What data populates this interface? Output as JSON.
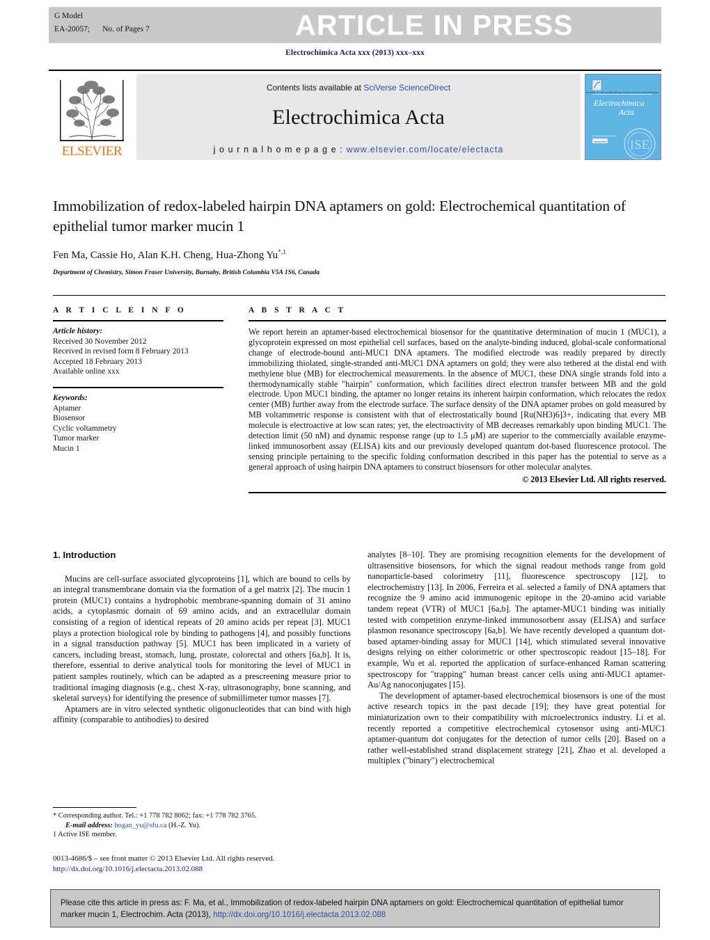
{
  "banner": {
    "g_model": "G Model",
    "article_id": "EA-20057;",
    "pages": "No. of Pages 7",
    "status": "ARTICLE IN PRESS"
  },
  "journal_citation": "Electrochimica Acta xxx (2013) xxx–xxx",
  "masthead": {
    "contents_prefix": "Contents lists available at ",
    "contents_link": "SciVerse ScienceDirect",
    "journal_name": "Electrochimica Acta",
    "homepage_prefix": "j o u r n a l  h o m e p a g e :  ",
    "homepage_url": "www.elsevier.com/locate/electacta",
    "publisher": "ELSEVIER",
    "cover_title_line1": "Electrochimica",
    "cover_title_line2": "Acta"
  },
  "article": {
    "title": "Immobilization of redox-labeled hairpin DNA aptamers on gold: Electrochemical quantitation of epithelial tumor marker mucin 1",
    "authors": "Fen Ma, Cassie Ho, Alan K.H. Cheng, Hua-Zhong Yu",
    "author_marks": "*,1",
    "affiliation": "Department of Chemistry, Simon Fraser University, Burnaby, British Columbia V5A 1S6, Canada"
  },
  "article_info": {
    "heading": "A R T I C L E   I N F O",
    "history_label": "Article history:",
    "history": [
      "Received 30 November 2012",
      "Received in revised form 8 February 2013",
      "Accepted 18 February 2013",
      "Available online xxx"
    ],
    "keywords_label": "Keywords:",
    "keywords": [
      "Aptamer",
      "Biosensor",
      "Cyclic voltammetry",
      "Tumor marker",
      "Mucin 1"
    ]
  },
  "abstract": {
    "heading": "A B S T R A C T",
    "text": "We report herein an aptamer-based electrochemical biosensor for the quantitative determination of mucin 1 (MUC1), a glycoprotein expressed on most epithelial cell surfaces, based on the analyte-binding induced, global-scale conformational change of electrode-bound anti-MUC1 DNA aptamers. The modified electrode was readily prepared by directly immobilizing thiolated, single-stranded anti-MUC1 DNA aptamers on gold; they were also tethered at the distal end with methylene blue (MB) for electrochemical measurements. In the absence of MUC1, these DNA single strands fold into a thermodynamically stable \"hairpin\" conformation, which facilities direct electron transfer between MB and the gold electrode. Upon MUC1 binding, the aptamer no longer retains its inherent hairpin conformation, which relocates the redox center (MB) further away from the electrode surface. The surface density of the DNA aptamer probes on gold measured by MB voltammetric response is consistent with that of electrostatically bound [Ru(NH3)6]3+, indicating that every MB molecule is electroactive at low scan rates; yet, the electroactivity of MB decreases remarkably upon binding MUC1. The detection limit (50 nM) and dynamic response range (up to 1.5 μM) are superior to the commercially available enzyme-linked immunosorbent assay (ELISA) kits and our previously developed quantum dot-based fluorescence protocol. The sensing principle pertaining to the specific folding conformation described in this paper has the potential to serve as a general approach of using hairpin DNA aptamers to construct biosensors for other molecular analytes.",
    "copyright": "© 2013 Elsevier Ltd. All rights reserved."
  },
  "body": {
    "section_heading": "1. Introduction",
    "left_paragraphs": [
      "Mucins are cell-surface associated glycoproteins [1], which are bound to cells by an integral transmembrane domain via the formation of a gel matrix [2]. The mucin 1 protein (MUC1) contains a hydrophobic membrane-spanning domain of 31 amino acids, a cytoplasmic domain of 69 amino acids, and an extracellular domain consisting of a region of identical repeats of 20 amino acids per repeat [3]. MUC1 plays a protection biological role by binding to pathogens [4], and possibly functions in a signal transduction pathway [5]. MUC1 has been implicated in a variety of cancers, including breast, stomach, lung, prostate, colorectal and others [6a,b]. It is, therefore, essential to derive analytical tools for monitoring the level of MUC1 in patient samples routinely, which can be adapted as a prescreening measure prior to traditional imaging diagnosis (e.g., chest X-ray, ultrasonography, bone scanning, and skeletal surveys) for identifying the presence of submillimeter tumor masses [7].",
      "Aptamers are in vitro selected synthetic oligonucleotides that can bind with high affinity (comparable to antibodies) to desired"
    ],
    "right_paragraphs": [
      "analytes [8–10]. They are promising recognition elements for the development of ultrasensitive biosensors, for which the signal readout methods range from gold nanoparticle-based colorimetry [11], fluorescence spectroscopy [12], to electrochemistry [13]. In 2006, Ferreira et al. selected a family of DNA aptamers that recognize the 9 amino acid immunogenic epitope in the 20-amino acid variable tandem repeat (VTR) of MUC1 [6a,b]. The aptamer-MUC1 binding was initially tested with competition enzyme-linked immunosorbent assay (ELISA) and surface plasmon resonance spectroscopy [6a,b]. We have recently developed a quantum dot-based aptamer-binding assay for MUC1 [14], which stimulated several innovative designs relying on either colorimetric or other spectroscopic readout [15–18]. For example, Wu et al. reported the application of surface-enhanced Raman scattering spectroscopy for \"trapping\" human breast cancer cells using anti-MUC1 aptamer-Au/Ag nanoconjugates [15].",
      "The development of aptamer-based electrochemical biosensors is one of the most active research topics in the past decade [19]; they have great potential for miniaturization own to their compatibility with microelectronics industry. Li et al. recently reported a competitive electrochemical cytosensor using anti-MUC1 aptamer-quantum dot conjugates for the detection of tumor cells [20]. Based on a rather well-established strand displacement strategy [21], Zhao et al. developed a multiplex (\"binary\") electrochemical"
    ]
  },
  "footnotes": {
    "corresponding": "* Corresponding author. Tel.: +1 778 782 8062; fax: +1 778 782 3765.",
    "email_label": "E-mail address:",
    "email": "hogan_yu@sfu.ca",
    "email_suffix": "(H.-Z. Yu).",
    "ise_note": "1 Active ISE member.",
    "issn_line": "0013-4686/$ – see front matter © 2013 Elsevier Ltd. All rights reserved.",
    "doi_line": "http://dx.doi.org/10.1016/j.electacta.2013.02.088"
  },
  "cite_box": {
    "prefix": "Please cite this article in press as: F. Ma, et al., Immobilization of redox-labeled hairpin DNA aptamers on gold: Electrochemical quantitation of epithelial tumor marker mucin 1, Electrochim. Acta (2013), ",
    "link": "http://dx.doi.org/10.1016/j.electacta.2013.02.088"
  },
  "colors": {
    "banner_grey": "#c8c8c8",
    "link_blue": "#2c4fa8",
    "citation_navy": "#1a1a6e",
    "elsevier_orange": "#E8761A",
    "cover_blue": "#5fb4e5"
  }
}
